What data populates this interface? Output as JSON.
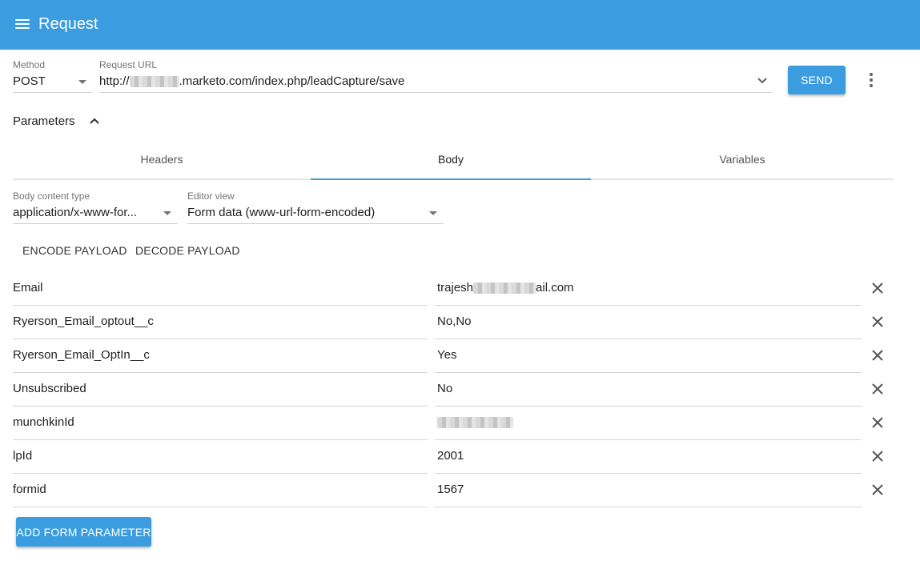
{
  "appbar": {
    "title": "Request",
    "menu_icon": "menu-icon"
  },
  "request": {
    "method_label": "Method",
    "method_value": "POST",
    "url_label": "Request URL",
    "url_prefix": "http://",
    "url_suffix": ".marketo.com/index.php/leadCapture/save",
    "send_label": "SEND"
  },
  "parameters": {
    "label": "Parameters"
  },
  "tabs": [
    {
      "label": "Headers",
      "active": false
    },
    {
      "label": "Body",
      "active": true
    },
    {
      "label": "Variables",
      "active": false
    }
  ],
  "body": {
    "content_type_label": "Body content type",
    "content_type_value": "application/x-www-for...",
    "editor_view_label": "Editor view",
    "editor_view_value": "Form data (www-url-form-encoded)",
    "encode_label": "ENCODE PAYLOAD",
    "decode_label": "DECODE PAYLOAD"
  },
  "form_params": [
    {
      "name": "Email",
      "value_prefix": "trajesh",
      "value_suffix": "ail.com"
    },
    {
      "name": "Ryerson_Email_optout__c",
      "value": "No,No"
    },
    {
      "name": "Ryerson_Email_OptIn__c",
      "value": "Yes"
    },
    {
      "name": "Unsubscribed",
      "value": "No"
    },
    {
      "name": "munchkinId",
      "value": ""
    },
    {
      "name": "lpId",
      "value": "2001"
    },
    {
      "name": "formid",
      "value": "1567"
    }
  ],
  "add_param_label": "ADD FORM PARAMETER",
  "colors": {
    "primary": "#3b9ddf",
    "text": "#212121",
    "muted": "#757575"
  }
}
